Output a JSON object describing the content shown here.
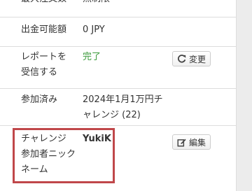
{
  "rows": [
    {
      "label": "最大注文数",
      "value": "無制限"
    },
    {
      "label": "出金可能額",
      "value": "0 JPY"
    },
    {
      "label": "レポートを\n受信する",
      "value": "完了",
      "button": {
        "label": "変更",
        "icon": "refresh-icon"
      }
    },
    {
      "label": "参加済み",
      "value": "2024年1月1万円チ\nャレンジ (22)"
    },
    {
      "label": "チャレンジ\n参加者ニック\nネーム",
      "value": "YukiK",
      "button": {
        "label": "編集",
        "icon": "edit-icon"
      }
    }
  ],
  "colors": {
    "success": "#3c9b3c",
    "highlight": "#c0474a",
    "border": "#dddddd"
  }
}
